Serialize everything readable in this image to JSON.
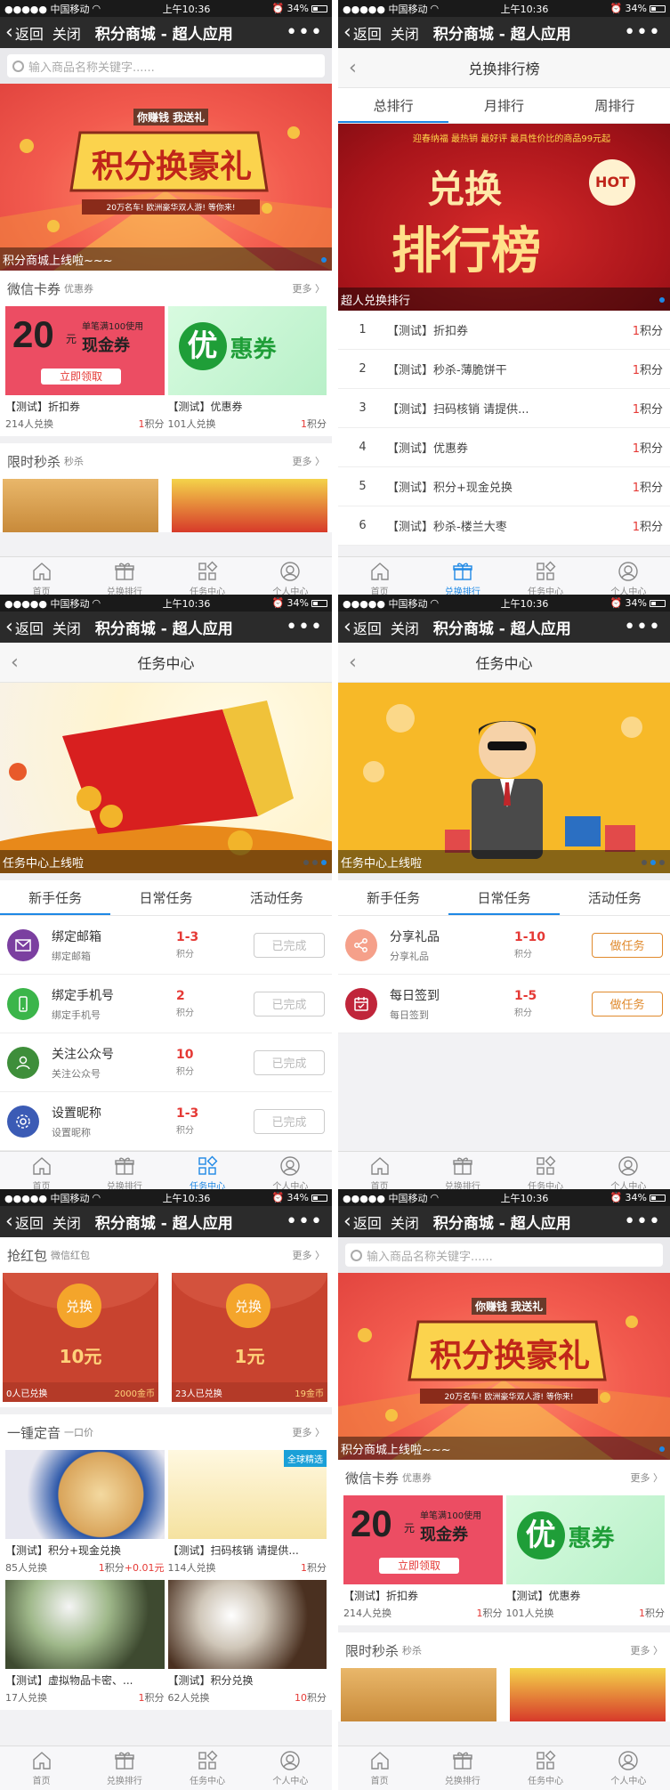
{
  "common": {
    "carrier": "●●●●● 中国移动",
    "time": "上午10:36",
    "battery": "34%",
    "back": "返回",
    "close": "关闭",
    "title": "积分商城 - 超人应用",
    "more": "•••",
    "tabs": [
      "首页",
      "兑换排行",
      "任务中心",
      "个人中心"
    ]
  },
  "home": {
    "search_placeholder": "输入商品名称关键字......",
    "banner_caption": "积分商城上线啦~~~",
    "banner_texts": [
      "你赚钱 我送礼",
      "积分换豪礼",
      "20万名车! 欧洲豪华双人游! 等你来!"
    ],
    "section_wechat": {
      "title": "微信卡券",
      "sub": "优惠券",
      "more": "更多 〉"
    },
    "coupon_art": {
      "value": "20",
      "unit": "元",
      "line1": "单笔满100使用",
      "line2": "现金券",
      "button": "立即领取",
      "you": "优",
      "hui": "惠券"
    },
    "coupons": [
      {
        "name": "【测试】折扣券",
        "count": "214人兑换",
        "points": "1",
        "unit": "积分"
      },
      {
        "name": "【测试】优惠券",
        "count": "101人兑换",
        "points": "1",
        "unit": "积分"
      }
    ],
    "section_flash": {
      "title": "限时秒杀",
      "sub": "秒杀",
      "more": "更多 〉"
    }
  },
  "ranking": {
    "title": "兑换排行榜",
    "tabs": [
      "总排行",
      "月排行",
      "周排行"
    ],
    "banner_caption": "超人兑换排行",
    "banner_texts": [
      "迎春纳福 最热销 最好评 最具性价比的商品99元起",
      "兑换",
      "排行榜",
      "HOT"
    ],
    "rows": [
      {
        "n": "1",
        "name": "【测试】折扣券",
        "pts": "1",
        "unit": "积分"
      },
      {
        "n": "2",
        "name": "【测试】秒杀-薄脆饼干",
        "pts": "1",
        "unit": "积分"
      },
      {
        "n": "3",
        "name": "【测试】扫码核销 请提供...",
        "pts": "1",
        "unit": "积分"
      },
      {
        "n": "4",
        "name": "【测试】优惠券",
        "pts": "1",
        "unit": "积分"
      },
      {
        "n": "5",
        "name": "【测试】积分+现金兑换",
        "pts": "1",
        "unit": "积分"
      },
      {
        "n": "6",
        "name": "【测试】秒杀-楼兰大枣",
        "pts": "1",
        "unit": "积分"
      }
    ]
  },
  "tasks": {
    "title": "任务中心",
    "banner_caption": "任务中心上线啦",
    "tabs": [
      "新手任务",
      "日常任务",
      "活动任务"
    ],
    "newbie": [
      {
        "name": "绑定邮箱",
        "desc": "绑定邮箱",
        "pts": "1-3",
        "unit": "积分",
        "btn": "已完成",
        "color": "#7b3fa0"
      },
      {
        "name": "绑定手机号",
        "desc": "绑定手机号",
        "pts": "2",
        "unit": "积分",
        "btn": "已完成",
        "color": "#3bb54a"
      },
      {
        "name": "关注公众号",
        "desc": "关注公众号",
        "pts": "10",
        "unit": "积分",
        "btn": "已完成",
        "color": "#3e8e3a"
      },
      {
        "name": "设置昵称",
        "desc": "设置昵称",
        "pts": "1-3",
        "unit": "积分",
        "btn": "已完成",
        "color": "#3b5bb5"
      }
    ],
    "daily": [
      {
        "name": "分享礼品",
        "desc": "分享礼品",
        "pts": "1-10",
        "unit": "积分",
        "btn": "做任务",
        "color": "#f5a08a"
      },
      {
        "name": "每日签到",
        "desc": "每日签到",
        "pts": "1-5",
        "unit": "积分",
        "btn": "做任务",
        "color": "#c0253a"
      }
    ]
  },
  "redpack": {
    "section": {
      "title": "抢红包",
      "sub": "微信红包",
      "more": "更多 〉"
    },
    "envelopes": [
      {
        "coin": "兑换",
        "value": "10元",
        "count": "0人已兑换",
        "price": "2000金币"
      },
      {
        "coin": "兑换",
        "value": "1元",
        "count": "23人已兑换",
        "price": "19金币"
      }
    ],
    "section2": {
      "title": "一锺定音",
      "sub": "一口价",
      "more": "更多 〉"
    },
    "badge": "全球精选",
    "items": [
      {
        "name": "【测试】积分+现金兑换",
        "count": "85人兑换",
        "points": "1",
        "unit": "积分",
        "extra": "+0.01元"
      },
      {
        "name": "【测试】扫码核销 请提供...",
        "count": "114人兑换",
        "points": "1",
        "unit": "积分",
        "extra": ""
      },
      {
        "name": "【测试】虚拟物品卡密、...",
        "count": "17人兑换",
        "points": "1",
        "unit": "积分",
        "extra": ""
      },
      {
        "name": "【测试】积分兑换",
        "count": "62人兑换",
        "points": "10",
        "unit": "积分",
        "extra": ""
      }
    ]
  },
  "colors": {
    "accent": "#1e88e5",
    "points": "#e53935",
    "nav": "#2b2b2b"
  }
}
